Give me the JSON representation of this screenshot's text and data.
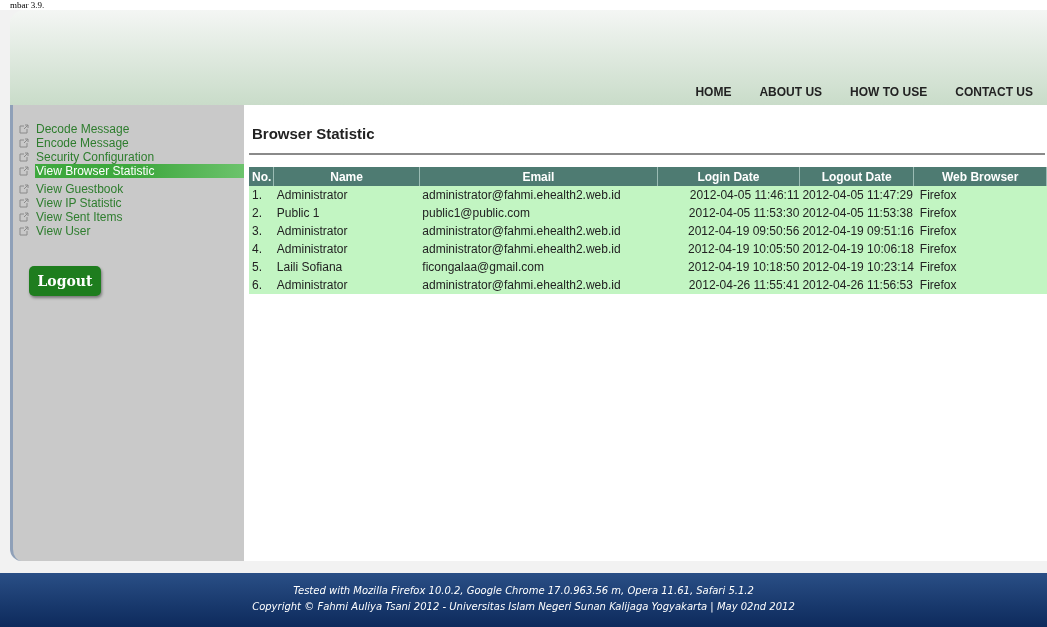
{
  "caption": "mbar 3.9.",
  "nav": [
    {
      "label": "HOME"
    },
    {
      "label": "ABOUT US"
    },
    {
      "label": "HOW TO USE"
    },
    {
      "label": "CONTACT US"
    }
  ],
  "sidebar": {
    "items": [
      {
        "label": "Decode Message",
        "selected": false
      },
      {
        "label": "Encode Message",
        "selected": false
      },
      {
        "label": "Security Configuration",
        "selected": false
      },
      {
        "label": "View Browser Statistic",
        "selected": true
      },
      {
        "label": "View Guestbook",
        "selected": false
      },
      {
        "label": "View IP Statistic",
        "selected": false
      },
      {
        "label": "View Sent Items",
        "selected": false
      },
      {
        "label": "View User",
        "selected": false
      }
    ],
    "logout": "Logout"
  },
  "page_title": "Browser Statistic",
  "table": {
    "columns": [
      "No.",
      "Name",
      "Email",
      "Login Date",
      "Logout Date",
      "Web Browser"
    ],
    "rows": [
      [
        "1.",
        "Administrator",
        "administrator@fahmi.ehealth2.web.id",
        "2012-04-05 11:46:11",
        "2012-04-05 11:47:29",
        "Firefox"
      ],
      [
        "2.",
        "Public 1",
        "public1@public.com",
        "2012-04-05 11:53:30",
        "2012-04-05 11:53:38",
        "Firefox"
      ],
      [
        "3.",
        "Administrator",
        "administrator@fahmi.ehealth2.web.id",
        "2012-04-19 09:50:56",
        "2012-04-19 09:51:16",
        "Firefox"
      ],
      [
        "4.",
        "Administrator",
        "administrator@fahmi.ehealth2.web.id",
        "2012-04-19 10:05:50",
        "2012-04-19 10:06:18",
        "Firefox"
      ],
      [
        "5.",
        "Laili Sofiana",
        "ficongalaa@gmail.com",
        "2012-04-19 10:18:50",
        "2012-04-19 10:23:14",
        "Firefox"
      ],
      [
        "6.",
        "Administrator",
        "administrator@fahmi.ehealth2.web.id",
        "2012-04-26 11:55:41",
        "2012-04-26 11:56:53",
        "Firefox"
      ]
    ]
  },
  "footer": [
    "Tested with Mozilla Firefox 10.0.2, Google Chrome 17.0.963.56 m, Opera 11.61, Safari 5.1.2",
    "Copyright © Fahmi Auliya Tsani 2012 - Universitas Islam Negeri Sunan Kalijaga Yogyakarta | May 02nd 2012"
  ]
}
